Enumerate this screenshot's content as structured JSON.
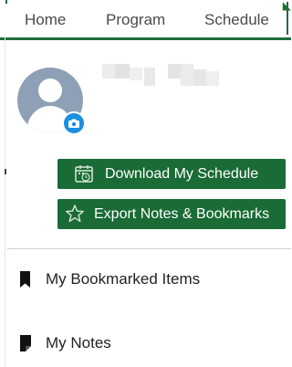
{
  "nav": {
    "tabs": [
      {
        "label": "Home"
      },
      {
        "label": "Program"
      },
      {
        "label": "Schedule"
      }
    ]
  },
  "profile": {
    "avatar_icon": "user-icon",
    "badge_icon": "camera-icon",
    "badge_color": "#1d8fe0"
  },
  "actions": {
    "download_label": "Download My Schedule",
    "download_icon": "calendar-icon",
    "export_label": "Export Notes & Bookmarks",
    "export_icon": "star-icon",
    "button_color": "#1a6b35"
  },
  "menu": {
    "items": [
      {
        "label": "My Bookmarked Items",
        "icon": "bookmark-icon"
      },
      {
        "label": "My Notes",
        "icon": "note-icon"
      }
    ]
  },
  "colors": {
    "accent": "#1f6e3a"
  }
}
